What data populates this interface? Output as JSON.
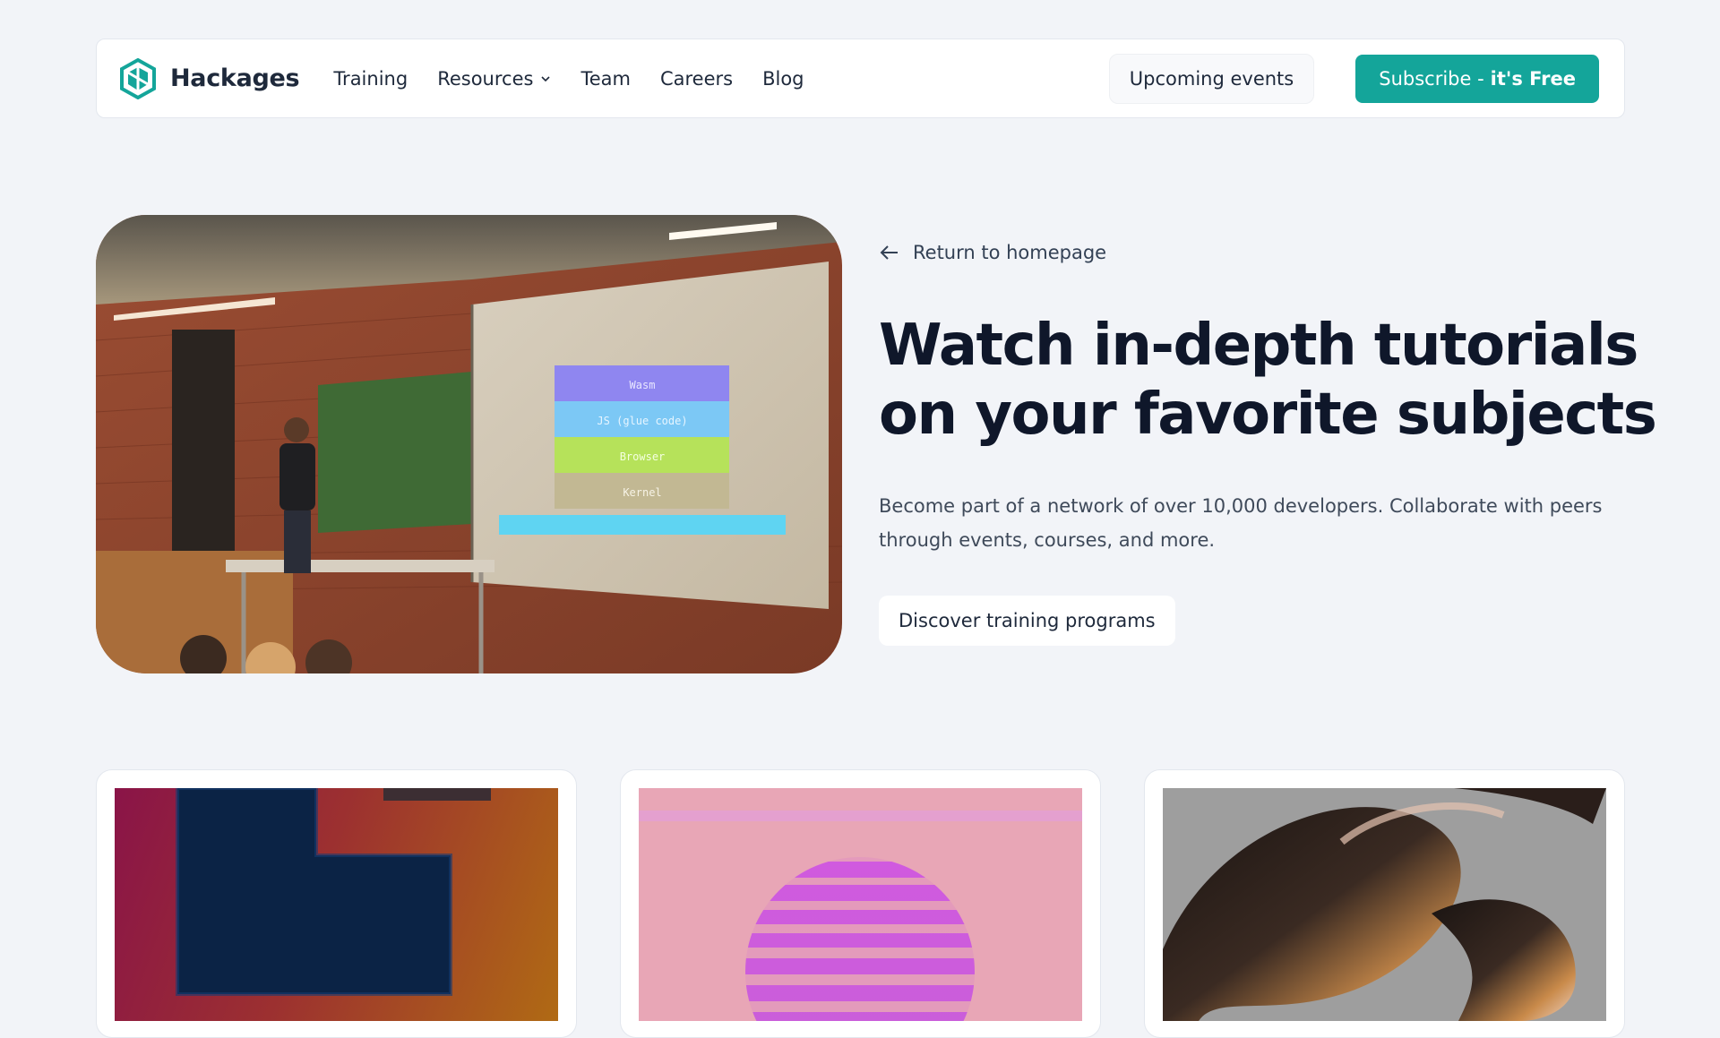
{
  "nav": {
    "brand": "Hackages",
    "links": [
      {
        "label": "Training"
      },
      {
        "label": "Resources",
        "has_dropdown": true
      },
      {
        "label": "Team"
      },
      {
        "label": "Careers"
      },
      {
        "label": "Blog"
      }
    ],
    "events_button": "Upcoming events",
    "subscribe_prefix": "Subscribe - ",
    "subscribe_emphasis": "it's Free",
    "accent_color": "#14a59a"
  },
  "hero": {
    "back_link": "Return to homepage",
    "title_line1": "Watch in-depth tutorials",
    "title_line2": "on your favorite subjects",
    "lead": "Become part of a network of over 10,000 developers. Collaborate with peers through events, courses, and more.",
    "cta": "Discover training programs",
    "slide_layers": [
      "Wasm",
      "JS (glue code)",
      "Browser",
      "Kernel"
    ]
  },
  "cards": [
    {
      "image": "abstract-blue-l-shape"
    },
    {
      "image": "pink-striped-sun"
    },
    {
      "image": "chrome-coil-3d"
    }
  ]
}
